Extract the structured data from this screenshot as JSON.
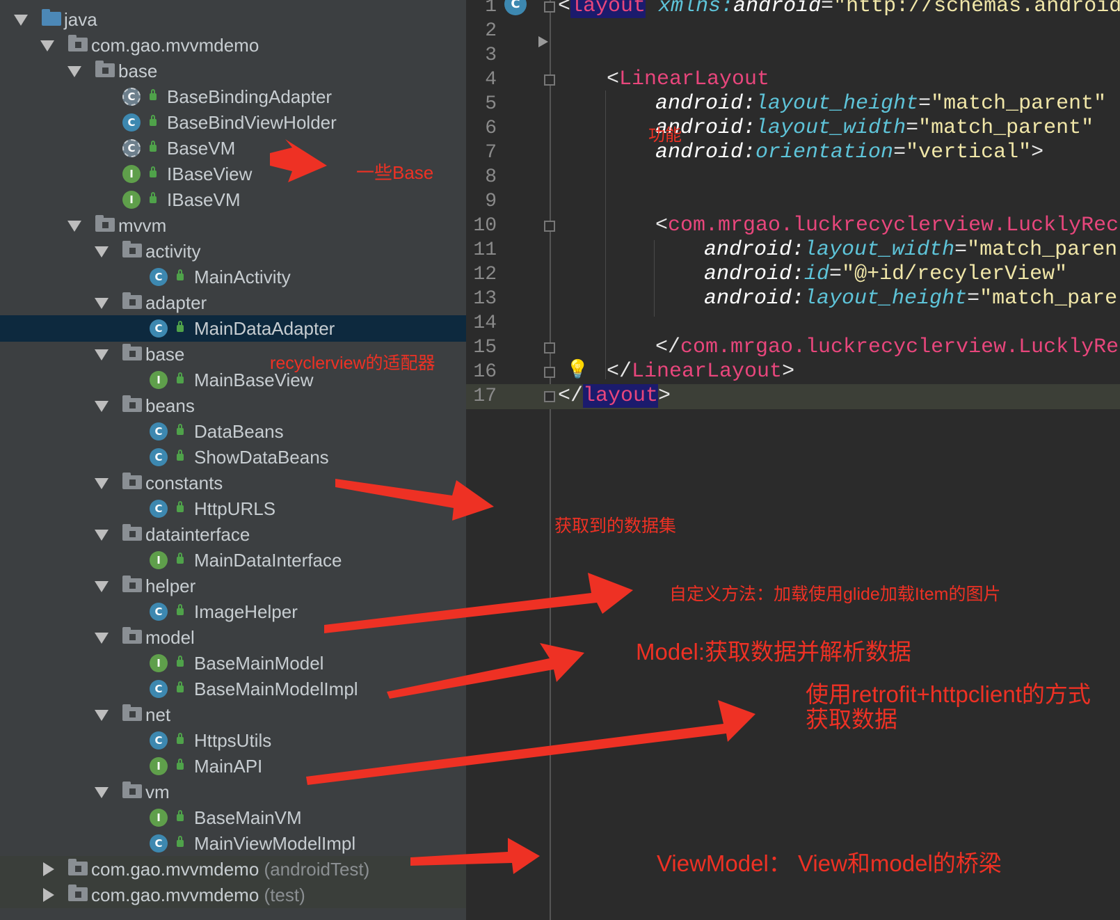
{
  "project_tree": {
    "rows": [
      {
        "label": "java",
        "sublabel": ""
      },
      {
        "label": "com.gao.mvvmdemo",
        "sublabel": ""
      },
      {
        "label": "base",
        "sublabel": ""
      },
      {
        "label": "BaseBindingAdapter",
        "sublabel": "",
        "badge": "C"
      },
      {
        "label": "BaseBindViewHolder",
        "sublabel": "",
        "badge": "C"
      },
      {
        "label": "BaseVM",
        "sublabel": "",
        "badge": "C"
      },
      {
        "label": "IBaseView",
        "sublabel": "",
        "badge": "I"
      },
      {
        "label": "IBaseVM",
        "sublabel": "",
        "badge": "I"
      },
      {
        "label": "mvvm",
        "sublabel": ""
      },
      {
        "label": "activity",
        "sublabel": ""
      },
      {
        "label": "MainActivity",
        "sublabel": "",
        "badge": "C"
      },
      {
        "label": "adapter",
        "sublabel": ""
      },
      {
        "label": "MainDataAdapter",
        "sublabel": "",
        "badge": "C"
      },
      {
        "label": "base",
        "sublabel": ""
      },
      {
        "label": "MainBaseView",
        "sublabel": "",
        "badge": "I"
      },
      {
        "label": "beans",
        "sublabel": ""
      },
      {
        "label": "DataBeans",
        "sublabel": "",
        "badge": "C"
      },
      {
        "label": "ShowDataBeans",
        "sublabel": "",
        "badge": "C"
      },
      {
        "label": "constants",
        "sublabel": ""
      },
      {
        "label": "HttpURLS",
        "sublabel": "",
        "badge": "C"
      },
      {
        "label": "datainterface",
        "sublabel": ""
      },
      {
        "label": "MainDataInterface",
        "sublabel": "",
        "badge": "I"
      },
      {
        "label": "helper",
        "sublabel": ""
      },
      {
        "label": "ImageHelper",
        "sublabel": "",
        "badge": "C"
      },
      {
        "label": "model",
        "sublabel": ""
      },
      {
        "label": "BaseMainModel",
        "sublabel": "",
        "badge": "I"
      },
      {
        "label": "BaseMainModelImpl",
        "sublabel": "",
        "badge": "C"
      },
      {
        "label": "net",
        "sublabel": ""
      },
      {
        "label": "HttpsUtils",
        "sublabel": "",
        "badge": "C"
      },
      {
        "label": "MainAPI",
        "sublabel": "",
        "badge": "I"
      },
      {
        "label": "vm",
        "sublabel": ""
      },
      {
        "label": "BaseMainVM",
        "sublabel": "",
        "badge": "I"
      },
      {
        "label": "MainViewModelImpl",
        "sublabel": "",
        "badge": "C"
      },
      {
        "label": "com.gao.mvvmdemo",
        "sublabel": "(androidTest)"
      },
      {
        "label": "com.gao.mvvmdemo",
        "sublabel": "(test)"
      }
    ]
  },
  "editor": {
    "line_numbers": [
      "1",
      "2",
      "3",
      "4",
      "5",
      "6",
      "7",
      "8",
      "9",
      "10",
      "11",
      "12",
      "13",
      "14",
      "15",
      "16",
      "17"
    ],
    "l1": {
      "open": "<",
      "tag": "layout",
      "sp": " ",
      "ns": "xmlns:",
      "attr": "android",
      "eq": "=",
      "val": "\"http://schemas.android"
    },
    "l4": {
      "open": "<",
      "tag": "LinearLayout"
    },
    "l5": {
      "ns": "android:",
      "attr": "layout_height",
      "eq": "=",
      "val": "\"match_parent\""
    },
    "l6": {
      "ns": "android:",
      "attr": "layout_width",
      "eq": "=",
      "val": "\"match_parent\""
    },
    "l7": {
      "ns": "android:",
      "attr": "orientation",
      "eq": "=",
      "val": "\"vertical\"",
      "close": ">"
    },
    "l10": {
      "open": "<",
      "tag": "com.mrgao.luckrecyclerview.LucklyRec"
    },
    "l11": {
      "ns": "android:",
      "attr": "layout_width",
      "eq": "=",
      "val": "\"match_paren"
    },
    "l12": {
      "ns": "android:",
      "attr": "id",
      "eq": "=",
      "val": "\"@+id/recylerView\""
    },
    "l13": {
      "ns": "android:",
      "attr": "layout_height",
      "eq": "=",
      "val": "\"match_pare"
    },
    "l15": {
      "open": "</",
      "tag": "com.mrgao.luckrecyclerview.LucklyRe"
    },
    "l16": {
      "open": "</",
      "tag": "LinearLayout",
      "close": ">"
    },
    "l17": {
      "open": "</",
      "tag": "layout",
      "close": ">"
    }
  },
  "annotations": {
    "base": "一些Base",
    "adapter": "recyclerview的适配器",
    "function": "功能",
    "beans": "获取到的数据集",
    "helper": "自定义方法：加载使用glide加载Item的图片",
    "model": "Model:获取数据并解析数据",
    "net_line1": "使用retrofit+httpclient的方式",
    "net_line2": "获取数据",
    "vm": "ViewModel： View和model的桥梁"
  },
  "colors": {
    "annotation": "#ee3124",
    "tag": "#e8467c",
    "attribute": "#5ec4d9",
    "value": "#f0e6a8",
    "selection": "#0d293e"
  }
}
